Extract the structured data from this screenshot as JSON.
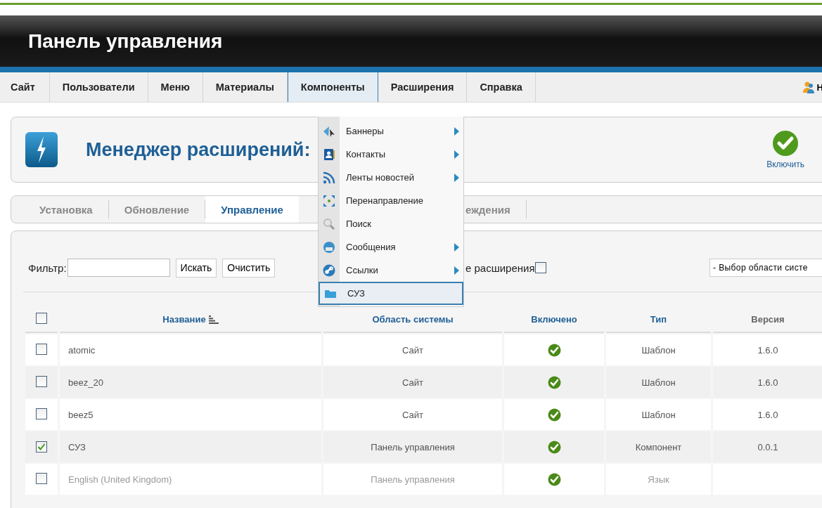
{
  "header": {
    "title": "Панель управления"
  },
  "menu": {
    "items": [
      {
        "label": "Сайт",
        "selected": false
      },
      {
        "label": "Пользователи",
        "selected": false
      },
      {
        "label": "Меню",
        "selected": false
      },
      {
        "label": "Материалы",
        "selected": false
      },
      {
        "label": "Компоненты",
        "selected": true
      },
      {
        "label": "Расширения",
        "selected": false
      },
      {
        "label": "Справка",
        "selected": false
      }
    ],
    "user": "Н"
  },
  "dropdown": {
    "items": [
      {
        "label": "Баннеры",
        "submenu": true,
        "selected": false
      },
      {
        "label": "Контакты",
        "submenu": true,
        "selected": false
      },
      {
        "label": "Ленты новостей",
        "submenu": true,
        "selected": false
      },
      {
        "label": "Перенаправление",
        "submenu": false,
        "selected": false
      },
      {
        "label": "Поиск",
        "submenu": false,
        "selected": false
      },
      {
        "label": "Сообщения",
        "submenu": true,
        "selected": false
      },
      {
        "label": "Ссылки",
        "submenu": true,
        "selected": false
      },
      {
        "label": "СУЗ",
        "submenu": false,
        "selected": true
      }
    ]
  },
  "toolbar": {
    "title": "Менеджер расширений:",
    "button": "Включить"
  },
  "subtabs": [
    {
      "label": "Установка",
      "selected": false
    },
    {
      "label": "Обновление",
      "selected": false
    },
    {
      "label": "Управление",
      "selected": true
    },
    {
      "label": "еждения",
      "selected": false
    }
  ],
  "filter": {
    "label": "Фильтр:",
    "search_button": "Искать",
    "clear_button": "Очистить",
    "checkbox_label": "е расширения",
    "checked": false,
    "select": "- Выбор области систе"
  },
  "table": {
    "all_checked": false,
    "columns": [
      {
        "label": "Название",
        "sortable": true,
        "sorted": true
      },
      {
        "label": "Область системы",
        "sortable": true,
        "sorted": false
      },
      {
        "label": "Включено",
        "sortable": true,
        "sorted": false
      },
      {
        "label": "Тип",
        "sortable": true,
        "sorted": false
      },
      {
        "label": "Версия",
        "sortable": false,
        "sorted": false
      }
    ],
    "rows": [
      {
        "checked": false,
        "name": "atomic",
        "area": "Сайт",
        "enabled": true,
        "type": "Шаблон",
        "version": "1.6.0",
        "dimmed": false
      },
      {
        "checked": false,
        "name": "beez_20",
        "area": "Сайт",
        "enabled": true,
        "type": "Шаблон",
        "version": "1.6.0",
        "dimmed": false
      },
      {
        "checked": false,
        "name": "beez5",
        "area": "Сайт",
        "enabled": true,
        "type": "Шаблон",
        "version": "1.6.0",
        "dimmed": false
      },
      {
        "checked": true,
        "name": "СУЗ",
        "area": "Панель управления",
        "enabled": true,
        "type": "Компонент",
        "version": "0.0.1",
        "dimmed": false
      },
      {
        "checked": false,
        "name": "English (United Kingdom)",
        "area": "Панель управления",
        "enabled": true,
        "type": "Язык",
        "dimmed": true
      }
    ]
  }
}
